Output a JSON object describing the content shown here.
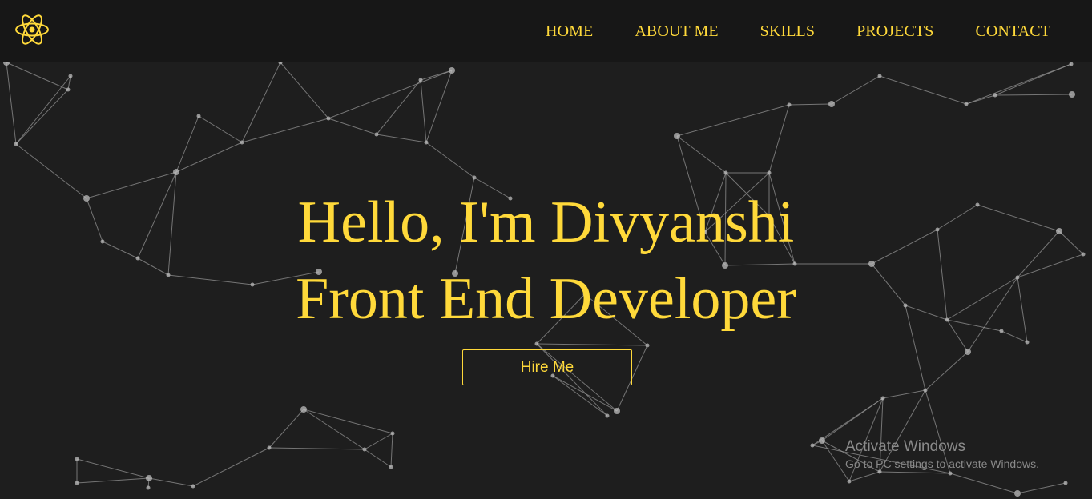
{
  "nav": {
    "logo": "react-atom-icon",
    "links": [
      "HOME",
      "ABOUT ME",
      "SKILLS",
      "PROJECTS",
      "CONTACT"
    ]
  },
  "hero": {
    "line1": "Hello, I'm Divyanshi",
    "line2": "Front End Developer",
    "button": "Hire Me"
  },
  "watermark": {
    "title": "Activate Windows",
    "subtitle": "Go to PC settings to activate Windows."
  },
  "colors": {
    "background": "#1e1e1e",
    "navbar": "#171717",
    "accent": "#ffd93a",
    "network_lines": "#9a9a9a",
    "network_nodes": "#bdbdbd"
  }
}
